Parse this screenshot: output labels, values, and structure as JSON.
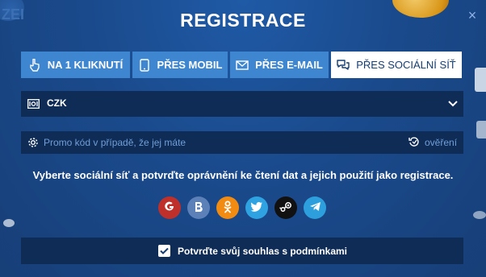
{
  "title": "REGISTRACE",
  "close_label": "×",
  "background_fragment": "ZEI",
  "tabs": [
    {
      "label": "NA 1 KLIKNUTÍ",
      "icon": "hand-pointer-icon"
    },
    {
      "label": "PŘES MOBIL",
      "icon": "phone-icon"
    },
    {
      "label": "PŘES E-MAIL",
      "icon": "envelope-icon"
    },
    {
      "label": "PŘES SOCIÁLNÍ SÍŤ",
      "icon": "chat-bubbles-icon",
      "active": true
    }
  ],
  "currency": {
    "value": "CZK",
    "icon": "currency-flag-icon"
  },
  "promo": {
    "placeholder": "Promo kód v případě, že jej máte",
    "verify_label": "ověření"
  },
  "message": "Vyberte sociální síť a potvrďte oprávnění ke čtení dat a jejich použití jako registrace.",
  "socials": [
    {
      "name": "google",
      "glyph": "G",
      "color": "#c0302b"
    },
    {
      "name": "vk",
      "glyph": "B",
      "color": "#5c80b8"
    },
    {
      "name": "odnoklassniki",
      "glyph": "ok",
      "color": "#f28b12"
    },
    {
      "name": "twitter",
      "glyph": "tw",
      "color": "#2fa2e2"
    },
    {
      "name": "steam",
      "glyph": "st",
      "color": "#111111"
    },
    {
      "name": "telegram",
      "glyph": "tg",
      "color": "#2d9fdc"
    }
  ],
  "agree": {
    "label": "Potvrďte svůj souhlas s podmínkami",
    "checked": true
  },
  "colors": {
    "tab": "#3f86d0",
    "row": "#0f2c57",
    "accent_text": "#6f9fd8"
  }
}
